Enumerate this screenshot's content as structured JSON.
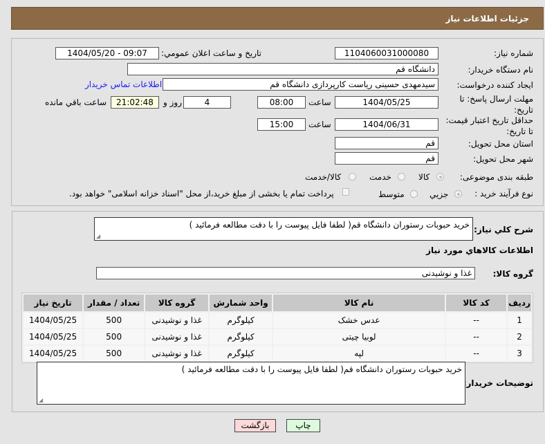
{
  "header": {
    "title": "جزئیات اطلاعات نیاز"
  },
  "form": {
    "need_number_label": "شماره نیاز:",
    "need_number": "1104060031000080",
    "announce_label": "تاریخ و ساعت اعلان عمومي:",
    "announce_value": "1404/05/20 - 09:07",
    "buyer_org_label": "نام دستگاه خریدار:",
    "buyer_org": "دانشگاه قم",
    "requester_label": "ایجاد کننده درخواست:",
    "requester": "سیدمهدی حسینی ریاست کارپردازی دانشگاه قم",
    "contact_link": "اطلاعات تماس خریدار",
    "deadline_label": "مهلت ارسال پاسخ: تا تاریخ:",
    "deadline_date": "1404/05/25",
    "time_label": "ساعت",
    "deadline_time": "08:00",
    "days": "4",
    "days_label": "روز و",
    "remaining": "21:02:48",
    "remaining_label": "ساعت باقي مانده",
    "validity_label": "حداقل تاریخ اعتبار قیمت: تا تاریخ:",
    "validity_date": "1404/06/31",
    "validity_time": "15:00",
    "province_label": "استان محل تحویل:",
    "province": "قم",
    "city_label": "شهر محل تحویل:",
    "city": "قم",
    "category_label": "طبقه بندی موضوعی:",
    "category_options": [
      "كالا",
      "خدمت",
      "كالا/خدمت"
    ],
    "process_label": "نوع فرآيند خريد :",
    "process_options": [
      "جزيي",
      "متوسط"
    ],
    "payment_note": "پرداخت تمام یا بخشی از مبلغ خرید،از محل \"اسناد خزانه اسلامی\" خواهد بود."
  },
  "details": {
    "description_label": "شرح کلي نياز:",
    "description": "خرید حبوبات رستوران دانشگاه قم( لطفا فایل پیوست را با دقت مطالعه فرمائید )",
    "goods_heading": "اطلاعات كالاهاي مورد نياز",
    "goods_group_label": "گروه کالا:",
    "goods_group": "غذا و نوشیدنی",
    "table": {
      "headers": [
        "رديف",
        "کد کالا",
        "نام کالا",
        "واحد شمارش",
        "گروه کالا",
        "تعداد / مقدار",
        "تاریخ نیاز"
      ],
      "rows": [
        [
          "1",
          "--",
          "عدس خشک",
          "کیلوگرم",
          "غذا و نوشیدنی",
          "500",
          "1404/05/25"
        ],
        [
          "2",
          "--",
          "لوبیا چیتی",
          "کیلوگرم",
          "غذا و نوشیدنی",
          "500",
          "1404/05/25"
        ],
        [
          "3",
          "--",
          "لپه",
          "کیلوگرم",
          "غذا و نوشیدنی",
          "500",
          "1404/05/25"
        ]
      ]
    },
    "buyer_notes_label": "توضیحات خریدار:",
    "buyer_notes": "خرید حبوبات رستوران دانشگاه قم( لطفا فایل پیوست را با دقت مطالعه فرمائید )"
  },
  "buttons": {
    "print": "چاپ",
    "back": "بازگشت"
  }
}
